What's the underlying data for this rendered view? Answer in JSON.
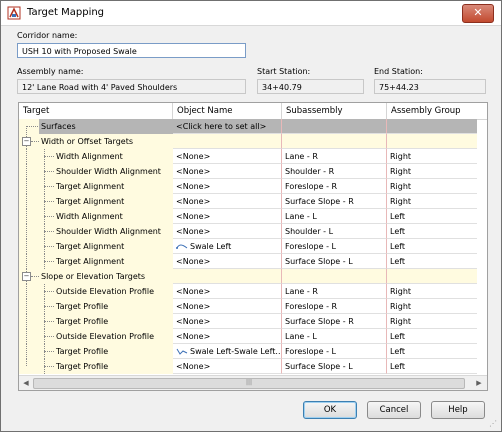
{
  "window": {
    "title": "Target Mapping",
    "close_label": "✕"
  },
  "corridor": {
    "label": "Corridor name:",
    "value": "USH 10 with Proposed Swale"
  },
  "assembly": {
    "label": "Assembly name:",
    "value": "12' Lane Road with 4' Paved Shoulders"
  },
  "start_station": {
    "label": "Start Station:",
    "value": "34+40.79"
  },
  "end_station": {
    "label": "End Station:",
    "value": "75+44.23"
  },
  "grid": {
    "columns": [
      "Target",
      "Object Name",
      "Subassembly",
      "Assembly Group"
    ],
    "rows": [
      {
        "type": "surf",
        "target": "Surfaces",
        "object": "<Click here to set all>",
        "sub": "",
        "group": ""
      },
      {
        "type": "group",
        "target": "Width or Offset Targets",
        "object": "",
        "sub": "",
        "group": ""
      },
      {
        "type": "item",
        "target": "Width Alignment",
        "object": "<None>",
        "sub": "Lane - R",
        "group": "Right"
      },
      {
        "type": "item",
        "target": "Shoulder Width Alignment",
        "object": "<None>",
        "sub": "Shoulder - R",
        "group": "Right"
      },
      {
        "type": "item",
        "target": "Target Alignment",
        "object": "<None>",
        "sub": "Foreslope - R",
        "group": "Right"
      },
      {
        "type": "item",
        "target": "Target Alignment",
        "object": "<None>",
        "sub": "Surface Slope - R",
        "group": "Right"
      },
      {
        "type": "item",
        "target": "Width Alignment",
        "object": "<None>",
        "sub": "Lane - L",
        "group": "Left"
      },
      {
        "type": "item",
        "target": "Shoulder Width Alignment",
        "object": "<None>",
        "sub": "Shoulder - L",
        "group": "Left"
      },
      {
        "type": "item",
        "target": "Target Alignment",
        "object": "Swale Left",
        "sub": "Foreslope - L",
        "group": "Left",
        "icon": "alignment-icon"
      },
      {
        "type": "item",
        "target": "Target Alignment",
        "object": "<None>",
        "sub": "Surface Slope - L",
        "group": "Left"
      },
      {
        "type": "group",
        "target": "Slope or Elevation Targets",
        "object": "",
        "sub": "",
        "group": ""
      },
      {
        "type": "item",
        "target": "Outside Elevation Profile",
        "object": "<None>",
        "sub": "Lane - R",
        "group": "Right"
      },
      {
        "type": "item",
        "target": "Target Profile",
        "object": "<None>",
        "sub": "Foreslope - R",
        "group": "Right"
      },
      {
        "type": "item",
        "target": "Target Profile",
        "object": "<None>",
        "sub": "Surface Slope - R",
        "group": "Right"
      },
      {
        "type": "item",
        "target": "Outside Elevation Profile",
        "object": "<None>",
        "sub": "Lane - L",
        "group": "Left"
      },
      {
        "type": "item",
        "target": "Target Profile",
        "object": "Swale Left-Swale Left...",
        "sub": "Foreslope - L",
        "group": "Left",
        "icon": "profile-icon"
      },
      {
        "type": "item",
        "target": "Target Profile",
        "object": "<None>",
        "sub": "Surface Slope - L",
        "group": "Left"
      }
    ]
  },
  "scrollbar": {
    "left_arrow": "◀",
    "right_arrow": "▶",
    "grip": "|||"
  },
  "buttons": {
    "ok": "OK",
    "cancel": "Cancel",
    "help": "Help"
  }
}
